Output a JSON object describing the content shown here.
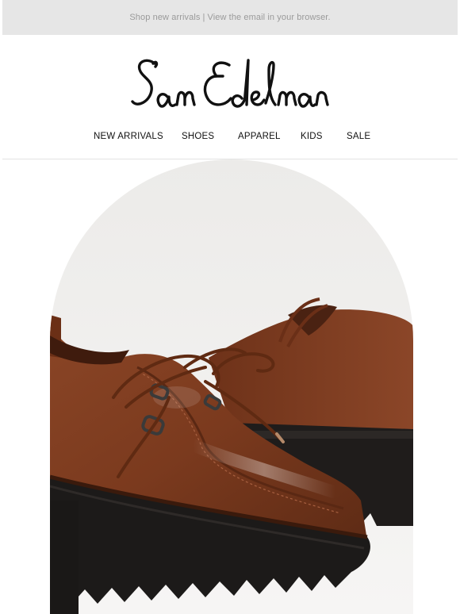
{
  "preheader": {
    "shop_link": "Shop new arrivals",
    "separator": "|",
    "browser_link": "View the email in your browser."
  },
  "brand": {
    "logo_text": "Sam Edelman"
  },
  "nav": {
    "items": [
      {
        "label": "NEW ARRIVALS"
      },
      {
        "label": "SHOES"
      },
      {
        "label": "APPAREL"
      },
      {
        "label": "KIDS"
      },
      {
        "label": "SALE"
      }
    ]
  },
  "hero": {
    "image": "brown-platform-loafer-shoes-photo",
    "colors": {
      "background": "#f0efed",
      "leather": "#7a3a1f",
      "sole": "#1c1a19"
    }
  }
}
